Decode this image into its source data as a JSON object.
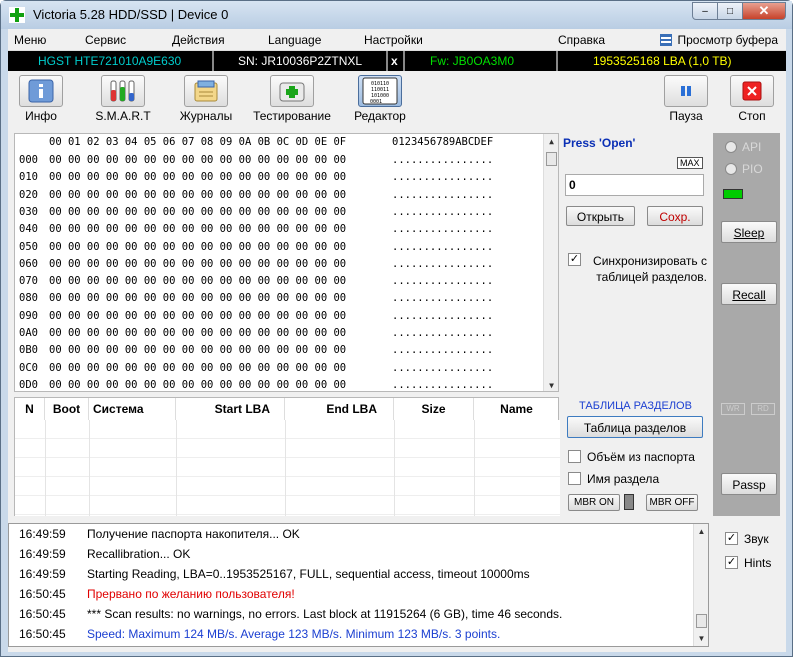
{
  "window": {
    "title": "Victoria 5.28 HDD/SSD | Device 0",
    "min": "–",
    "max": "□",
    "close": "✕"
  },
  "menu": {
    "items": [
      "Меню",
      "Сервис",
      "Действия",
      "Language",
      "Настройки",
      "Справка"
    ],
    "buffer": "Просмотр буфера"
  },
  "drive": {
    "model": "HGST HTE721010A9E630",
    "serial": "SN: JR10036P2ZTNXL",
    "x": "x",
    "firmware": "Fw: JB0OA3M0",
    "capacity": "1953525168 LBA (1,0 TB)"
  },
  "toolbar": {
    "info": "Инфо",
    "smart": "S.M.A.R.T",
    "journals": "Журналы",
    "testing": "Тестирование",
    "editor": "Редактор",
    "editor_glyph": "010110 110011 101000 0001",
    "pause": "Пауза",
    "stop": "Стоп"
  },
  "hex": {
    "header_bytes": "00 01 02 03 04 05 06 07 08 09 0A 0B 0C 0D 0E 0F",
    "header_ascii": "0123456789ABCDEF",
    "offsets": [
      "000",
      "010",
      "020",
      "030",
      "040",
      "050",
      "060",
      "070",
      "080",
      "090",
      "0A0",
      "0B0",
      "0C0",
      "0D0"
    ],
    "row_bytes": "00 00 00 00 00 00 00 00 00 00 00 00 00 00 00 00",
    "row_ascii": "................"
  },
  "sector": {
    "press_open": "Press 'Open'",
    "max": "MAX",
    "value": "0",
    "open": "Открыть",
    "save": "Сохр.",
    "sync_label_1": "Синхронизировать с",
    "sync_label_2": "таблицей разделов.",
    "sync_checked": "✓"
  },
  "partitions": {
    "columns": [
      "N",
      "Boot",
      "Система",
      "Start LBA",
      "End LBA",
      "Size",
      "Name"
    ],
    "section_title": "ТАБЛИЦА РАЗДЕЛОВ",
    "table_button": "Таблица разделов",
    "passport_volume": "Объём из паспорта",
    "partition_name": "Имя раздела",
    "mbr_on": "MBR ON",
    "mbr_off": "MBR OFF"
  },
  "side": {
    "api": "API",
    "pio": "PIO",
    "sleep": "Sleep",
    "recall": "Recall",
    "wr": "WR",
    "rd": "RD",
    "passp": "Passp"
  },
  "log": [
    {
      "time": "16:49:59",
      "msg": "Получение паспорта накопителя... OK",
      "color": "#000000"
    },
    {
      "time": "16:49:59",
      "msg": "Recallibration... OK",
      "color": "#000000"
    },
    {
      "time": "16:49:59",
      "msg": "Starting Reading, LBA=0..1953525167, FULL, sequential access, timeout 10000ms",
      "color": "#000000"
    },
    {
      "time": "16:50:45",
      "msg": "Прервано по желанию пользователя!",
      "color": "#e00000"
    },
    {
      "time": "16:50:45",
      "msg": "*** Scan results: no warnings, no errors. Last block at 11915264 (6 GB), time 46 seconds.",
      "color": "#000000"
    },
    {
      "time": "16:50:45",
      "msg": "Speed: Maximum 124 MB/s. Average 123 MB/s. Minimum 123 MB/s. 3 points.",
      "color": "#1b3fd1"
    }
  ],
  "options": {
    "sound": "Звук",
    "hints": "Hints",
    "checked": "✓"
  },
  "colors": {
    "accent_green": "#00cc00",
    "firmware_green": "#00e000",
    "serial_white": "#ffffff",
    "capacity_yellow": "#ffff00",
    "model_cyan": "#00cccc",
    "press_blue": "#0a2fb5"
  }
}
